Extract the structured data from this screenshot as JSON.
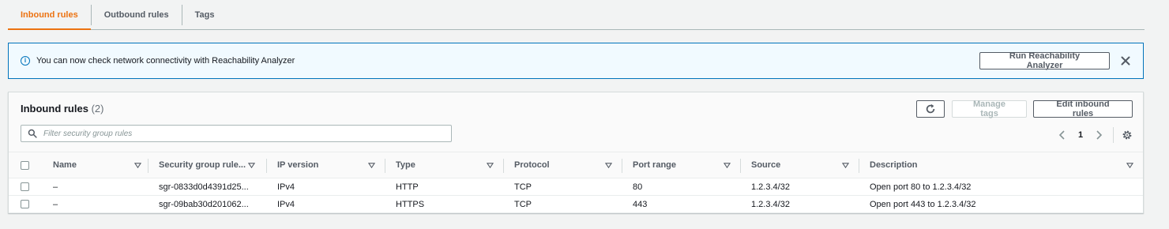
{
  "tabs": [
    {
      "label": "Inbound rules",
      "active": true
    },
    {
      "label": "Outbound rules",
      "active": false
    },
    {
      "label": "Tags",
      "active": false
    }
  ],
  "flash": {
    "message": "You can now check network connectivity with Reachability Analyzer",
    "button_label": "Run Reachability Analyzer",
    "icon": "info-icon"
  },
  "panel": {
    "title": "Inbound rules",
    "count": "(2)",
    "manage_tags_label": "Manage tags",
    "edit_label": "Edit inbound rules",
    "filter_placeholder": "Filter security group rules",
    "filter_value": "",
    "page": "1"
  },
  "table": {
    "columns": [
      "Name",
      "Security group rule...",
      "IP version",
      "Type",
      "Protocol",
      "Port range",
      "Source",
      "Description"
    ],
    "rows": [
      {
        "name": "–",
        "sgr": "sgr-0833d0d4391d25...",
        "ipv": "IPv4",
        "type": "HTTP",
        "protocol": "TCP",
        "port": "80",
        "source": "1.2.3.4/32",
        "description": "Open port 80 to 1.2.3.4/32"
      },
      {
        "name": "–",
        "sgr": "sgr-09bab30d201062...",
        "ipv": "IPv4",
        "type": "HTTPS",
        "protocol": "TCP",
        "port": "443",
        "source": "1.2.3.4/32",
        "description": "Open port 443 to 1.2.3.4/32"
      }
    ]
  },
  "colors": {
    "accent": "#ec7211",
    "info_blue": "#0073bb",
    "flash_bg": "#f1faff"
  }
}
